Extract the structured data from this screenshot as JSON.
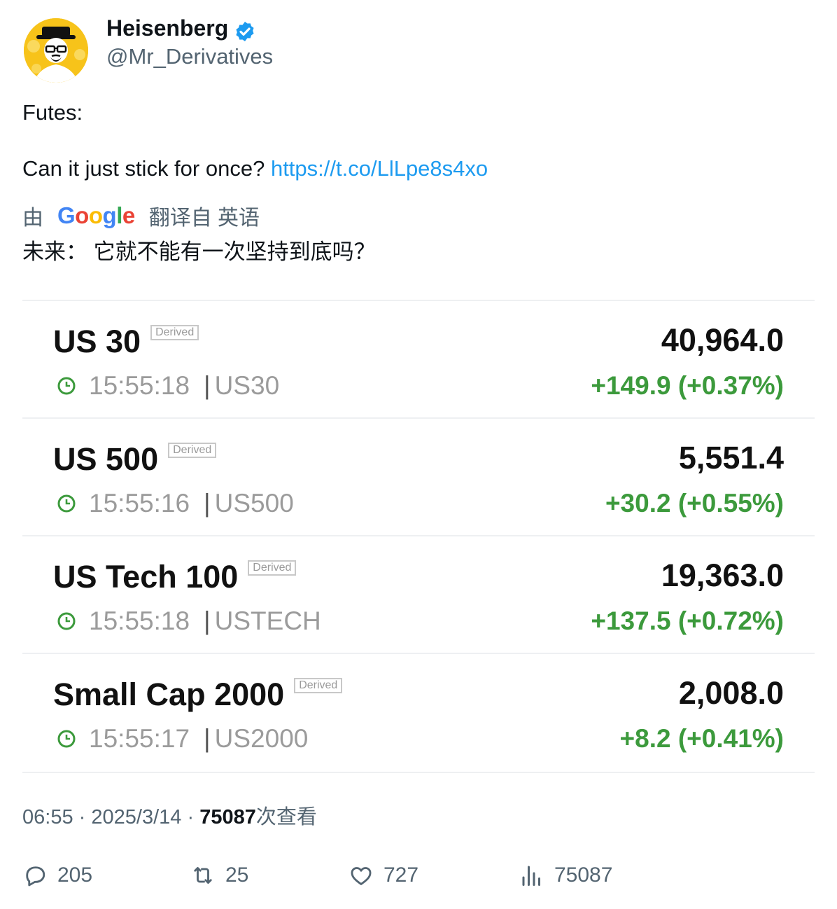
{
  "author": {
    "display_name": "Heisenberg",
    "handle": "@Mr_Derivatives",
    "verified_icon": "verified-badge-icon",
    "avatar_icon": "heisenberg-avatar"
  },
  "tweet": {
    "line1": "Futes:",
    "line2": "Can it just stick for once?",
    "link": "https://t.co/LlLpe8s4xo"
  },
  "translation": {
    "prefix": "由",
    "provider": "Google",
    "suffix": "翻译自 英语",
    "text": "未来： 它就不能有一次坚持到底吗？"
  },
  "quotes": [
    {
      "name": "US 30",
      "badge": "Derived",
      "time": "15:55:18",
      "symbol": "US30",
      "price": "40,964.0",
      "change": "+149.9 (+0.37%)"
    },
    {
      "name": "US 500",
      "badge": "Derived",
      "time": "15:55:16",
      "symbol": "US500",
      "price": "5,551.4",
      "change": "+30.2 (+0.55%)"
    },
    {
      "name": "US Tech 100",
      "badge": "Derived",
      "time": "15:55:18",
      "symbol": "USTECH",
      "price": "19,363.0",
      "change": "+137.5 (+0.72%)"
    },
    {
      "name": "Small Cap 2000",
      "badge": "Derived",
      "time": "15:55:17",
      "symbol": "US2000",
      "price": "2,008.0",
      "change": "+8.2 (+0.41%)"
    }
  ],
  "colors": {
    "accent_link": "#1d9bf0",
    "positive_change": "#3c9a3c",
    "muted_text": "#536471"
  },
  "meta": {
    "time": "06:55",
    "dot": "·",
    "date": "2025/3/14",
    "views": "75087",
    "views_label": "次查看"
  },
  "actions": {
    "replies": "205",
    "retweets": "25",
    "likes": "727",
    "views": "75087"
  }
}
